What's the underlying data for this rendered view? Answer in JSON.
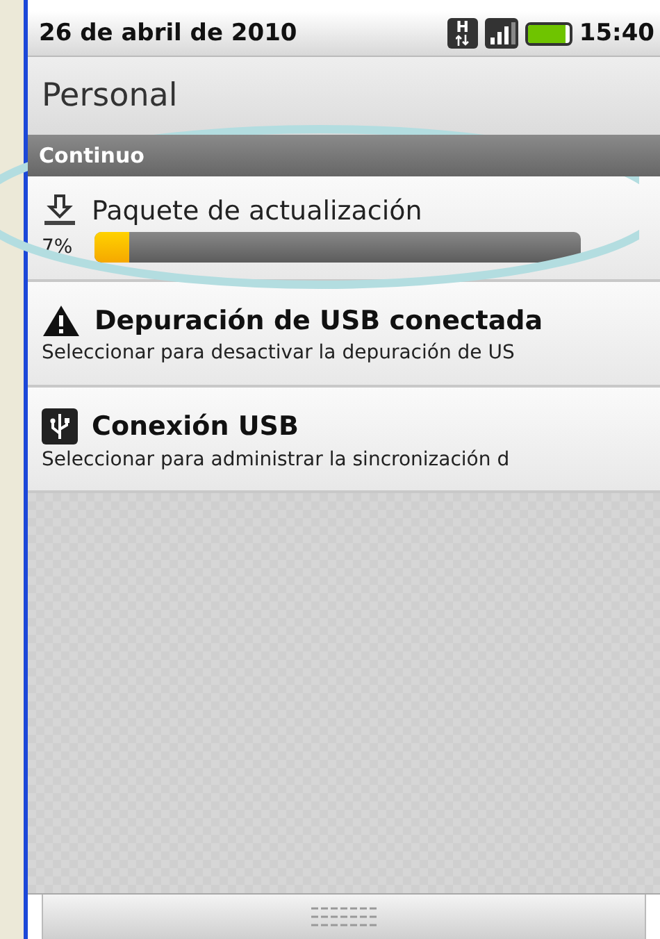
{
  "status_bar": {
    "date": "26 de abril de 2010",
    "time": "15:40",
    "network_label": "H"
  },
  "header": {
    "title": "Personal"
  },
  "section": {
    "title": "Continuo"
  },
  "progress_notification": {
    "title": "Paquete de actualización",
    "percent": "7%",
    "level": 0.07
  },
  "notifications": [
    {
      "kind": "warning",
      "title": "Depuración de USB conectada",
      "text": "Seleccionar para desactivar la depuración de US"
    },
    {
      "kind": "usb",
      "title": "Conexión USB",
      "text": "Seleccionar para administrar la sincronización d"
    }
  ]
}
